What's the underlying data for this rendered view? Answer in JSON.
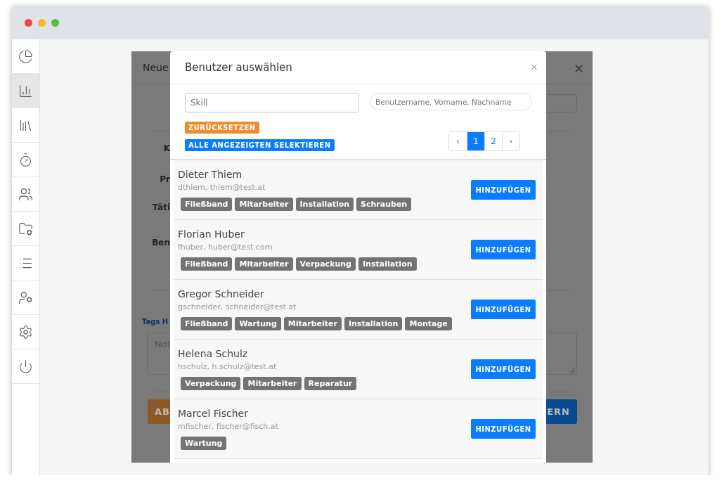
{
  "sidebar": {
    "items": [
      {
        "selected": false
      },
      {
        "selected": true
      },
      {
        "selected": false
      },
      {
        "selected": false
      },
      {
        "selected": false
      },
      {
        "selected": false
      },
      {
        "selected": false
      },
      {
        "selected": false
      },
      {
        "selected": false
      },
      {
        "selected": false
      }
    ]
  },
  "back_dialog": {
    "title": "Neue",
    "close": "×",
    "labels": [
      "K",
      "Pr",
      "Täti",
      "Ben"
    ],
    "tags_link": "Tags H",
    "notes_placeholder": "Not",
    "cancel_button": "AB",
    "save_button": "ERN"
  },
  "dialog": {
    "title": "Benutzer auswählen",
    "close": "×",
    "skill_field": {
      "placeholder": "Skill"
    },
    "search_field": {
      "placeholder": "Benutzername, Vorname, Nachname"
    },
    "reset_button": "ZURÜCKSETZEN",
    "select_all_button": "ALLE ANGEZEIGTEN SELEKTIEREN",
    "pagination": [
      {
        "label": "‹",
        "selected": false
      },
      {
        "label": "1",
        "selected": true
      },
      {
        "label": "2",
        "selected": false
      },
      {
        "label": "›",
        "selected": false
      }
    ],
    "users": [
      {
        "name": "Dieter Thiem",
        "details": "dthiem, thiem@test.at",
        "tags": [
          "Fließband",
          "Mitarbeiter",
          "Installation",
          "Schrauben"
        ],
        "button": "HINZUFÜGEN"
      },
      {
        "name": "Florian Huber",
        "details": "fhuber, huber@test.com",
        "tags": [
          "Fließband",
          "Mitarbeiter",
          "Verpackung",
          "Installation"
        ],
        "button": "HINZUFÜGEN"
      },
      {
        "name": "Gregor Schneider",
        "details": "gschneider, schneider@test.at",
        "tags": [
          "Fließband",
          "Wartung",
          "Mitarbeiter",
          "Installation",
          "Montage"
        ],
        "button": "HINZUFÜGEN"
      },
      {
        "name": "Helena Schulz",
        "details": "hschulz, h.schulz@test.at",
        "tags": [
          "Verpackung",
          "Mitarbeiter",
          "Reparatur"
        ],
        "button": "HINZUFÜGEN"
      },
      {
        "name": "Marcel Fischer",
        "details": "mfischer, fischer@fisch.at",
        "tags": [
          "Wartung"
        ],
        "button": "HINZUFÜGEN"
      }
    ]
  }
}
